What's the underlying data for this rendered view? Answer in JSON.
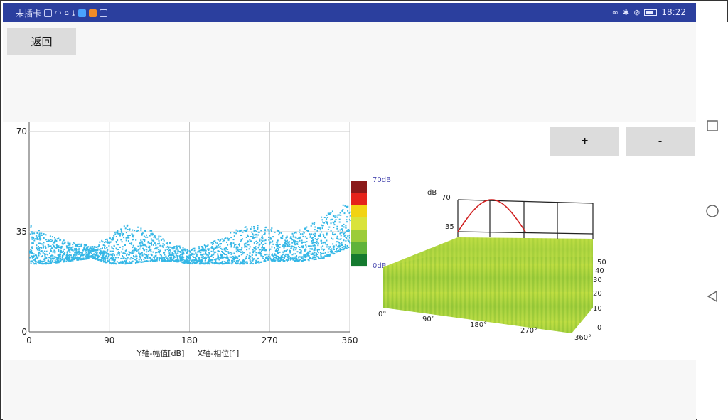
{
  "status_bar": {
    "carrier": "未插卡",
    "time": "18:22"
  },
  "toolbar": {
    "back_label": "返回",
    "zoom_in_label": "+",
    "zoom_out_label": "-"
  },
  "colors": {
    "scatter": "#35b7e6",
    "surface": "#a8d43a",
    "peak_curve": "#d02020",
    "status_bar": "#2b3f9e"
  },
  "chart_data": [
    {
      "type": "scatter",
      "xlabel": "X轴-相位[°]",
      "ylabel": "Y轴-幅值[dB]",
      "xlim": [
        0,
        360
      ],
      "ylim": [
        0,
        70
      ],
      "xticks": [
        "0",
        "90",
        "180",
        "270",
        "360"
      ],
      "yticks": [
        "0",
        "35",
        "70"
      ],
      "grid": true,
      "band_profile": {
        "phase": [
          0,
          20,
          45,
          70,
          90,
          110,
          135,
          160,
          180,
          200,
          225,
          250,
          270,
          290,
          310,
          330,
          345,
          360
        ],
        "amplitude_min": [
          24,
          24,
          25,
          26,
          24,
          24,
          25,
          25,
          24,
          24,
          24,
          24,
          25,
          25,
          25,
          26,
          28,
          30
        ],
        "amplitude_max": [
          38,
          34,
          32,
          30,
          34,
          38,
          36,
          31,
          29,
          31,
          35,
          38,
          37,
          34,
          37,
          41,
          44,
          46
        ]
      },
      "colorbar": {
        "top_label": "70dB",
        "bottom_label": "0dB",
        "colors": [
          "#8b1a1a",
          "#e5231b",
          "#f2d313",
          "#d9e33a",
          "#9ccc3a",
          "#5fb33a",
          "#157a2f"
        ]
      }
    },
    {
      "type": "surface3d",
      "zlabel": "dB",
      "zticks": [
        "70",
        "35"
      ],
      "xticks": [
        "0°",
        "90°",
        "180°",
        "270°",
        "360°"
      ],
      "yticks": [
        "0",
        "10",
        "20",
        "30",
        "40",
        "50"
      ],
      "peak_curve": {
        "phase": [
          0,
          45,
          90,
          135,
          180
        ],
        "amplitude": [
          35,
          59,
          70,
          59,
          35
        ]
      }
    }
  ]
}
